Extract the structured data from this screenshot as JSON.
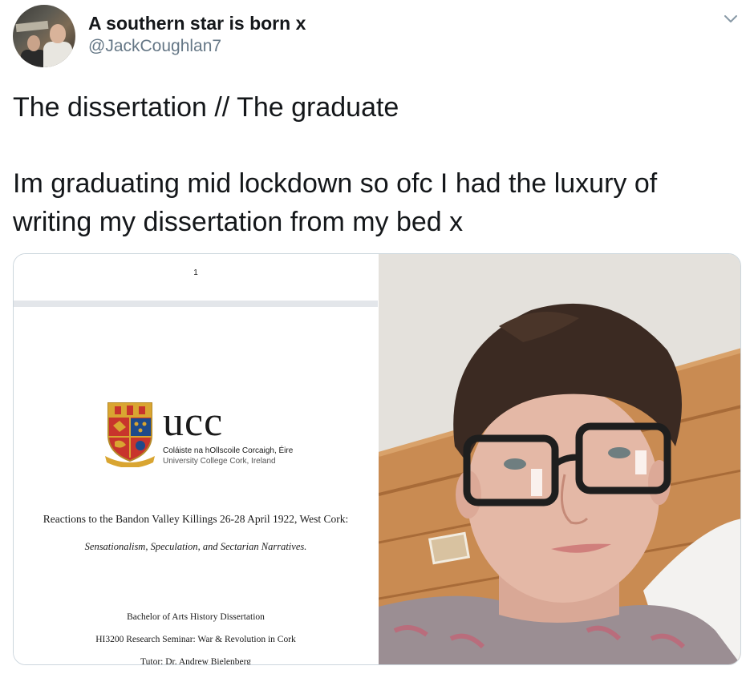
{
  "author": {
    "display_name": "A southern star is born x",
    "handle": "@JackCoughlan7"
  },
  "tweet": {
    "line1": "The dissertation // The graduate",
    "line2": "Im graduating mid lockdown so ofc I had the luxury of",
    "line3": "writing my dissertation from my bed x"
  },
  "icons": {
    "caret": "chevron-down-icon",
    "crest": "ucc-crest-icon"
  },
  "document": {
    "page_number": "1",
    "logo_text": "ucc",
    "logo_irish": "Coláiste na hOllscoile Corcaigh, Éire",
    "logo_english": "University College Cork, Ireland",
    "title": "Reactions to the Bandon Valley Killings 26-28 April 1922, West Cork:",
    "subtitle": "Sensationalism, Speculation, and Sectarian Narratives.",
    "degree": "Bachelor of Arts History Dissertation",
    "seminar": "HI3200 Research Seminar: War & Revolution in Cork",
    "tutor": "Tutor: Dr. Andrew Bielenberg"
  },
  "colors": {
    "text": "#14171a",
    "secondary": "#657786",
    "border": "#ccd6dd"
  }
}
